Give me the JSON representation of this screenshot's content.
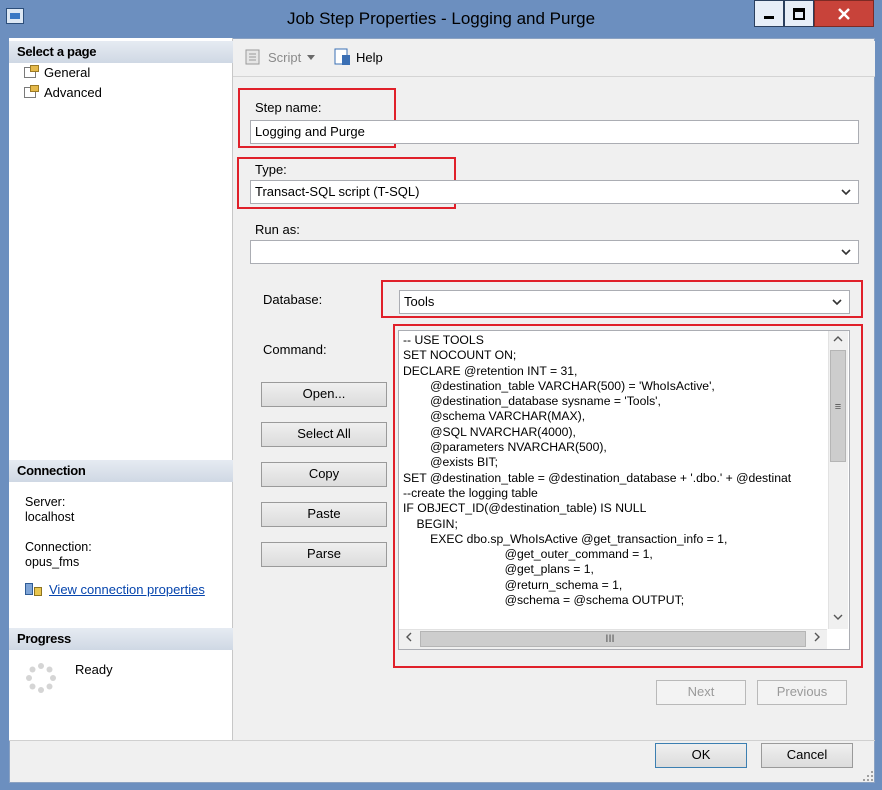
{
  "window": {
    "title": "Job Step Properties - Logging and Purge"
  },
  "left_panel": {
    "select_page_header": "Select a page",
    "pages": [
      "General",
      "Advanced"
    ],
    "connection_header": "Connection",
    "server_label": "Server:",
    "server_value": "localhost",
    "connection_label": "Connection:",
    "connection_value": "opus_fms",
    "view_connection_properties": "View connection properties",
    "progress_header": "Progress",
    "progress_status": "Ready"
  },
  "toolbar": {
    "script_label": "Script",
    "help_label": "Help"
  },
  "form": {
    "step_name_label": "Step name:",
    "step_name_value": "Logging and Purge",
    "type_label": "Type:",
    "type_value": "Transact-SQL script (T-SQL)",
    "run_as_label": "Run as:",
    "run_as_value": "",
    "database_label": "Database:",
    "database_value": "Tools",
    "command_label": "Command:",
    "command_text": "-- USE TOOLS\nSET NOCOUNT ON;\nDECLARE @retention INT = 31,\n        @destination_table VARCHAR(500) = 'WhoIsActive',\n        @destination_database sysname = 'Tools',\n        @schema VARCHAR(MAX),\n        @SQL NVARCHAR(4000),\n        @parameters NVARCHAR(500),\n        @exists BIT;\nSET @destination_table = @destination_database + '.dbo.' + @destinat\n--create the logging table\nIF OBJECT_ID(@destination_table) IS NULL\n    BEGIN;\n        EXEC dbo.sp_WhoIsActive @get_transaction_info = 1,\n                              @get_outer_command = 1,\n                              @get_plans = 1,\n                              @return_schema = 1,\n                              @schema = @schema OUTPUT;"
  },
  "command_buttons": {
    "open": "Open...",
    "select_all": "Select All",
    "copy": "Copy",
    "paste": "Paste",
    "parse": "Parse"
  },
  "nav": {
    "next": "Next",
    "previous": "Previous"
  },
  "footer": {
    "ok": "OK",
    "cancel": "Cancel"
  },
  "scrollbar": {
    "hthumb_glyph": "III",
    "vthumb_glyph": "≡"
  }
}
